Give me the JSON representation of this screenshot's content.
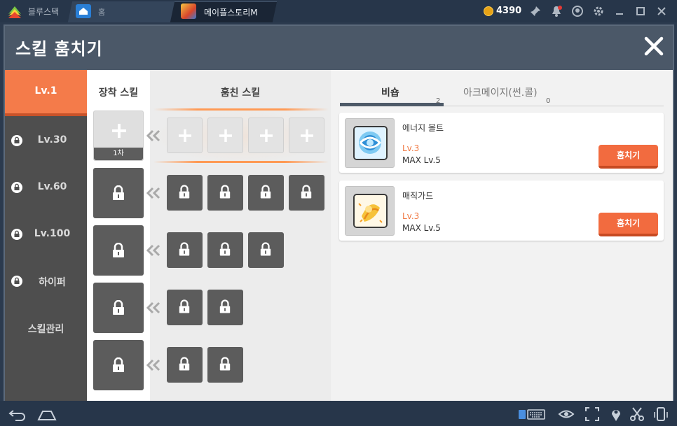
{
  "app": {
    "brand": "블루스택",
    "home_tab": "홈",
    "game_tab": "메이플스토리M",
    "coins": "4390"
  },
  "dialog": {
    "title": "스킬 훔치기",
    "close_icon": "close-icon"
  },
  "sidebar": {
    "items": [
      {
        "label": "Lv.1",
        "locked": false,
        "active": true
      },
      {
        "label": "Lv.30",
        "locked": true,
        "active": false
      },
      {
        "label": "Lv.60",
        "locked": true,
        "active": false
      },
      {
        "label": "Lv.100",
        "locked": true,
        "active": false
      },
      {
        "label": "하이퍼",
        "locked": true,
        "active": false
      },
      {
        "label": "스킬관리",
        "locked": false,
        "active": false
      }
    ]
  },
  "equip": {
    "header": "장착 스킬",
    "first_slot_tag": "1차"
  },
  "stolen": {
    "header": "훔친 스킬"
  },
  "tabs": [
    {
      "label": "비숍",
      "count": "2",
      "active": true
    },
    {
      "label": "아크메이지(썬.콜)",
      "count": "0",
      "active": false
    }
  ],
  "skills": [
    {
      "name": "에너지 볼트",
      "level": "Lv.3",
      "max": "MAX Lv.5",
      "button": "훔치기",
      "icon": "energy-bolt-icon"
    },
    {
      "name": "매직가드",
      "level": "Lv.3",
      "max": "MAX Lv.5",
      "button": "훔치기",
      "icon": "magic-guard-icon"
    }
  ],
  "colors": {
    "accent": "#f26b3f",
    "sidebar": "#4e4e4e",
    "locked_slot": "#5c5c5c"
  }
}
